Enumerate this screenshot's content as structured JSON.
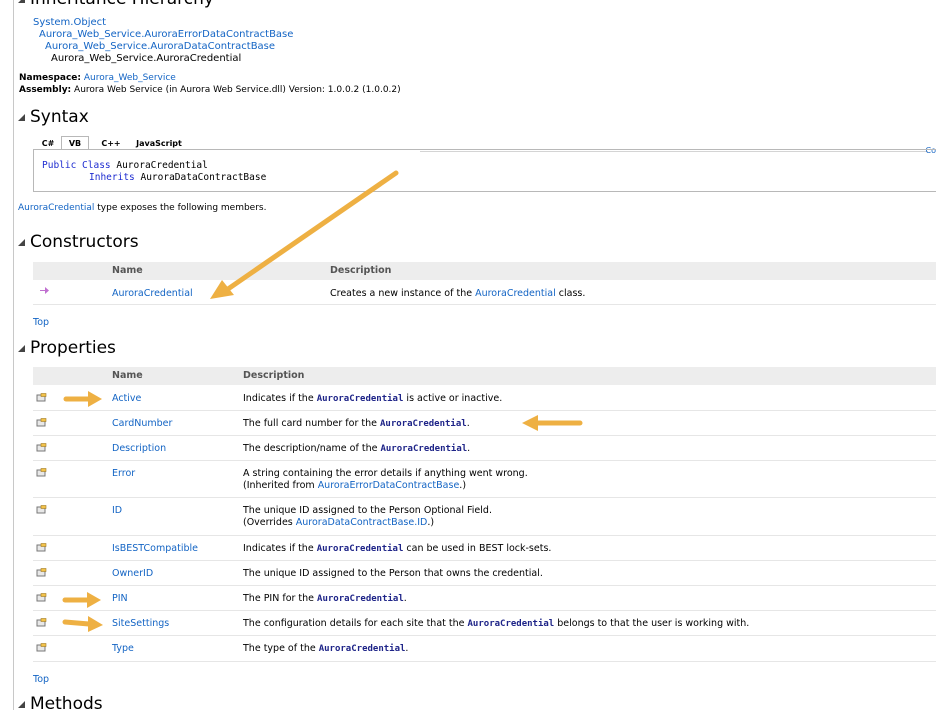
{
  "hierarchy": {
    "heading": "Inheritance Hierarchy",
    "items": [
      "System.Object",
      "Aurora_Web_Service.AuroraErrorDataContractBase",
      "Aurora_Web_Service.AuroraDataContractBase",
      "Aurora_Web_Service.AuroraCredential"
    ]
  },
  "namespace": {
    "label": "Namespace:",
    "value": "Aurora_Web_Service"
  },
  "assembly": {
    "label": "Assembly:",
    "value": "Aurora Web Service (in Aurora Web Service.dll) Version: 1.0.0.2 (1.0.0.2)"
  },
  "syntax": {
    "heading": "Syntax",
    "tabs": [
      "C#",
      "VB",
      "C++",
      "JavaScript"
    ],
    "selected_tab": "VB",
    "copy_label": "Co",
    "line1_kw": "Public Class",
    "line1_name": " AuroraCredential",
    "line2_kw": "Inherits",
    "line2_name": " AuroraDataContractBase"
  },
  "exposes": {
    "type_link": "AuroraCredential",
    "text": " type exposes the following members."
  },
  "constructors": {
    "heading": "Constructors",
    "col_name": "Name",
    "col_desc": "Description",
    "rows": [
      {
        "name": "AuroraCredential",
        "desc_pre": "Creates a new instance of the ",
        "desc_link": "AuroraCredential",
        "desc_post": " class."
      }
    ],
    "top": "Top"
  },
  "properties": {
    "heading": "Properties",
    "col_name": "Name",
    "col_desc": "Description",
    "rows": [
      {
        "name": "Active",
        "pre": "Indicates if the ",
        "code": "AuroraCredential",
        "post": " is active or inactive.",
        "line2": ""
      },
      {
        "name": "CardNumber",
        "pre": "The full card number for the ",
        "code": "AuroraCredential",
        "post": ".",
        "line2": ""
      },
      {
        "name": "Description",
        "pre": "The description/name of the ",
        "code": "AuroraCredential",
        "post": ".",
        "line2": ""
      },
      {
        "name": "Error",
        "pre": "A string containing the error details if anything went wrong.",
        "code": "",
        "post": "",
        "line2_pre": "(Inherited from ",
        "line2_link": "AuroraErrorDataContractBase",
        "line2_post": ".)"
      },
      {
        "name": "ID",
        "pre": "The unique ID assigned to the Person Optional Field.",
        "code": "",
        "post": "",
        "line2_pre": "(Overrides ",
        "line2_link": "AuroraDataContractBase.ID",
        "line2_post": ".)"
      },
      {
        "name": "IsBESTCompatible",
        "pre": "Indicates if the ",
        "code": "AuroraCredential",
        "post": " can be used in BEST lock-sets.",
        "line2": ""
      },
      {
        "name": "OwnerID",
        "pre": "The unique ID assigned to the Person that owns the credential.",
        "code": "",
        "post": "",
        "line2": ""
      },
      {
        "name": "PIN",
        "pre": "The PIN for the ",
        "code": "AuroraCredential",
        "post": ".",
        "line2": ""
      },
      {
        "name": "SiteSettings",
        "pre": "The configuration details for each site that the ",
        "code": "AuroraCredential",
        "post": " belongs to that the user is working with.",
        "line2": ""
      },
      {
        "name": "Type",
        "pre": "The type of the ",
        "code": "AuroraCredential",
        "post": ".",
        "line2": ""
      }
    ],
    "top": "Top"
  },
  "methods": {
    "heading": "Methods"
  },
  "colors": {
    "link": "#1364c4",
    "arrow": "#f0b43c",
    "header_bg": "#ededed"
  },
  "icons": [
    "constructor-icon",
    "property-icon",
    "arrow-annotation"
  ]
}
